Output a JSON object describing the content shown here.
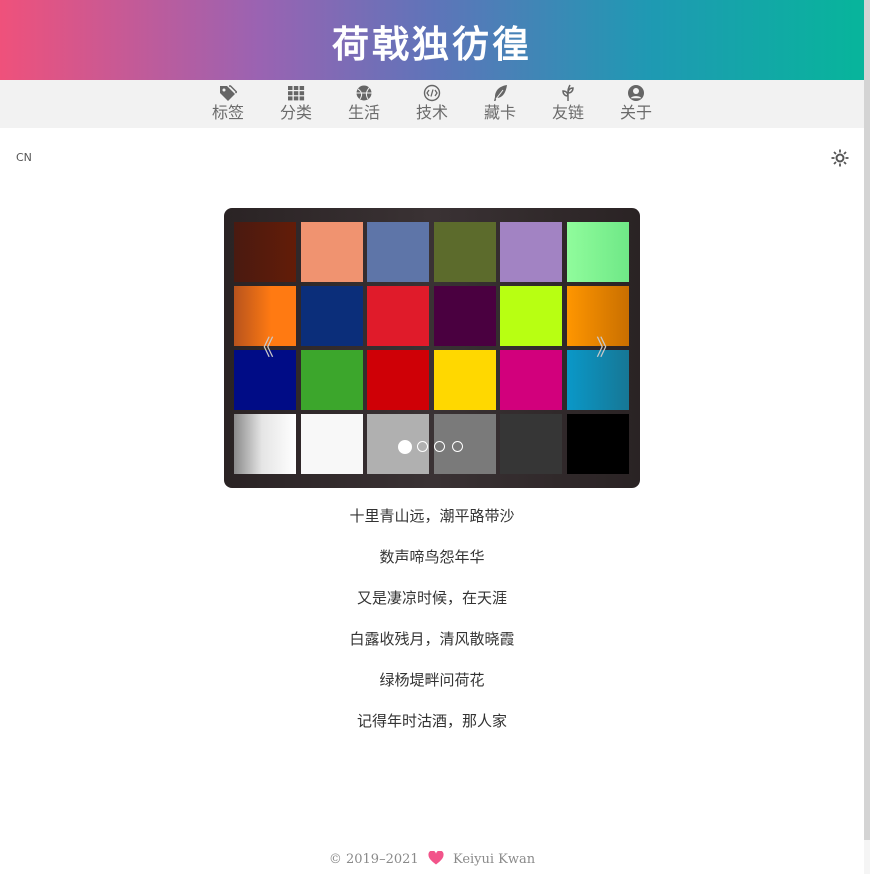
{
  "site": {
    "title": "荷戟独彷徨"
  },
  "nav": {
    "items": [
      {
        "label": "标签",
        "icon": "tag-icon"
      },
      {
        "label": "分类",
        "icon": "grid-icon"
      },
      {
        "label": "生活",
        "icon": "basketball-icon"
      },
      {
        "label": "技术",
        "icon": "code-icon"
      },
      {
        "label": "藏卡",
        "icon": "feather-icon"
      },
      {
        "label": "友链",
        "icon": "seedling-icon"
      },
      {
        "label": "关于",
        "icon": "user-circle-icon"
      }
    ]
  },
  "toolbar": {
    "lang_label": "CN",
    "theme_icon": "sun-icon"
  },
  "carousel": {
    "prev_label": "《",
    "next_label": "》",
    "slide_count": 4,
    "active_index": 0,
    "swatch_colors": [
      "#5a1a0d",
      "#f09370",
      "#5e75a8",
      "#5c6b2c",
      "#a283c3",
      "#86f79a",
      "#e26a16",
      "#0b2e7a",
      "#e01b2a",
      "#4a0040",
      "#b8ff12",
      "#ff8f00",
      "#000c86",
      "#3ca62c",
      "#cf0006",
      "#ffd800",
      "#d2007c",
      "#0f93c5",
      "#e7e7e7",
      "#f8f8f8",
      "#b0b0b0",
      "#7a7a7a",
      "#363636",
      "#000000"
    ]
  },
  "poem": {
    "lines": [
      "十里青山远，潮平路带沙",
      "数声啼鸟怨年华",
      "又是凄凉时候，在天涯",
      "白露收残月，清风散晓霞",
      "绿杨堤畔问荷花",
      "记得年时沽酒，那人家"
    ]
  },
  "footer": {
    "years": "© 2019–2021",
    "author": "Keiyui Kwan",
    "heart_icon": "heart-icon",
    "heart_color": "#f2548a"
  },
  "colors": {
    "nav_text": "#6b6b6b",
    "header_start": "#ef517b",
    "header_end": "#07b59b"
  }
}
